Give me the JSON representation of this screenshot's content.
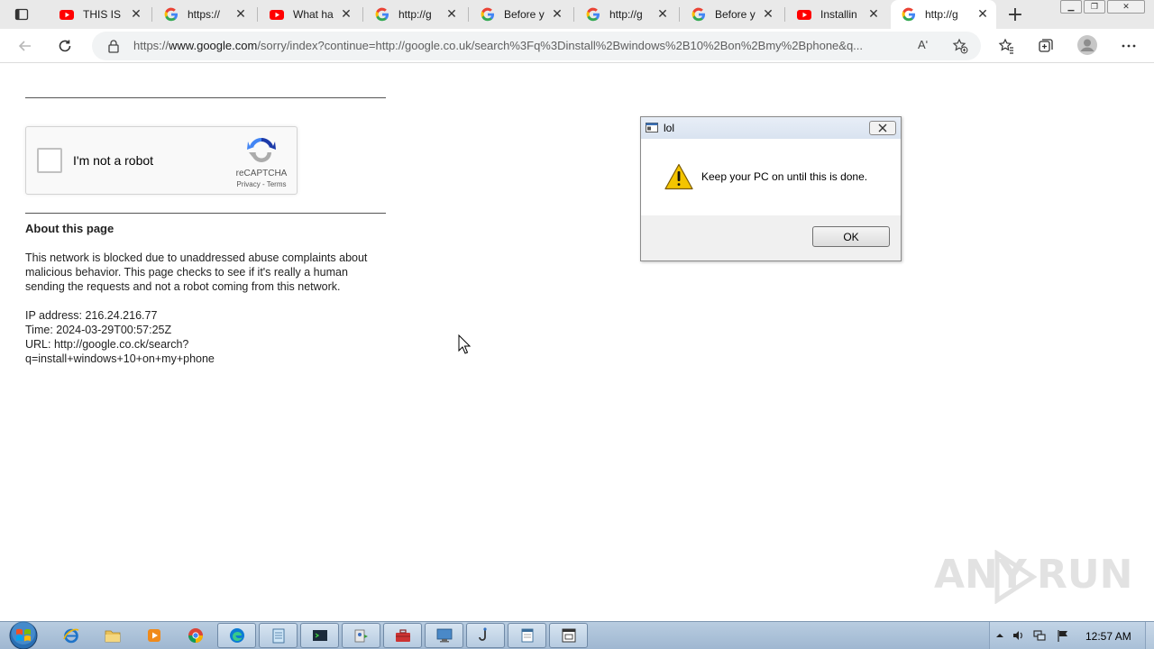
{
  "browser": {
    "tabs": [
      {
        "title": "THIS IS",
        "favicon": "youtube-icon"
      },
      {
        "title": "https://",
        "favicon": "google-icon"
      },
      {
        "title": "What ha",
        "favicon": "youtube-icon"
      },
      {
        "title": "http://g",
        "favicon": "google-icon"
      },
      {
        "title": "Before y",
        "favicon": "google-icon"
      },
      {
        "title": "http://g",
        "favicon": "google-icon"
      },
      {
        "title": "Before y",
        "favicon": "google-icon"
      },
      {
        "title": "Installin",
        "favicon": "youtube-icon"
      },
      {
        "title": "http://g",
        "favicon": "google-icon",
        "active": true
      }
    ],
    "url_prefix": "https://",
    "url_domain": "www.google.com",
    "url_rest": "/sorry/index?continue=http://google.co.uk/search%3Fq%3Dinstall%2Bwindows%2B10%2Bon%2Bmy%2Bphone&q...",
    "read_aloud_label": "Aʹ"
  },
  "page": {
    "recaptcha": {
      "checkbox_label": "I'm not a robot",
      "brand": "reCAPTCHA",
      "terms": "Privacy - Terms"
    },
    "about_heading": "About this page",
    "about_text": "This network is blocked due to unaddressed abuse complaints about malicious behavior. This page checks to see if it's really a human sending the requests and not a robot coming from this network.",
    "ip_line": "IP address: 216.24.216.77",
    "time_line": "Time: 2024-03-29T00:57:25Z",
    "url_line_1": "URL: http://google.co.ck/search?",
    "url_line_2": "q=install+windows+10+on+my+phone"
  },
  "dialog": {
    "title": "lol",
    "message": "Keep your PC on until this is done.",
    "ok_label": "OK"
  },
  "watermark": {
    "left": "ANY",
    "right": "RUN"
  },
  "taskbar": {
    "clock": "12:57 AM"
  },
  "colors": {
    "youtube_red": "#ff0000",
    "warning_yellow": "#f4c400",
    "taskbar_blue": "#a9c0d8"
  }
}
